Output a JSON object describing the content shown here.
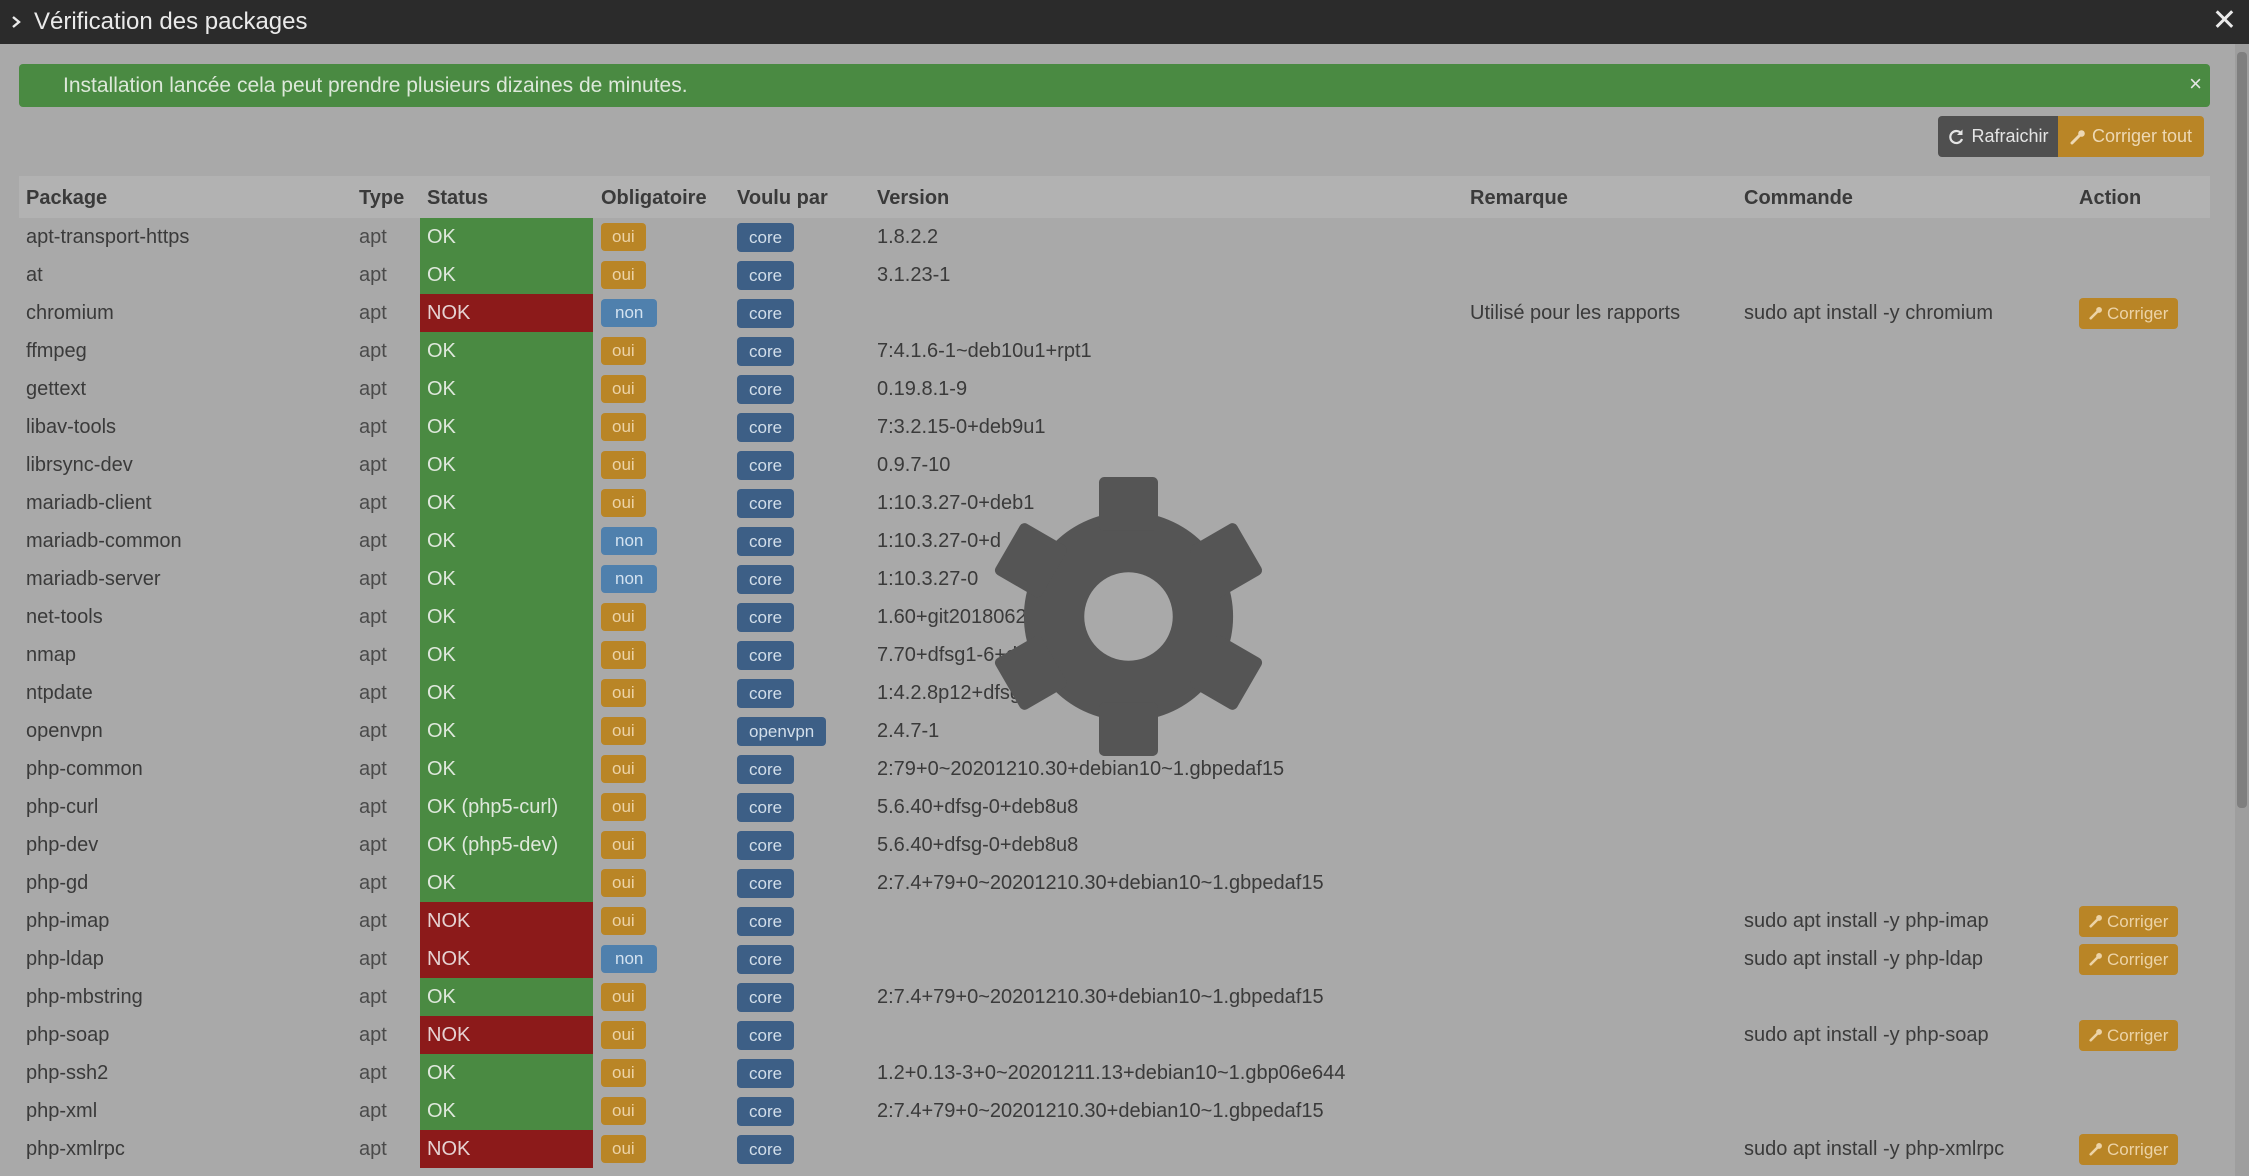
{
  "dialog": {
    "title": "Vérification des packages"
  },
  "alert": {
    "message": "Installation lancée cela peut prendre plusieurs dizaines de minutes.",
    "close": "×"
  },
  "toolbar": {
    "refresh_label": "Rafraichir",
    "fix_all_label": "Corriger tout"
  },
  "columns": {
    "package": "Package",
    "type": "Type",
    "status": "Status",
    "required": "Obligatoire",
    "wanted_by": "Voulu par",
    "version": "Version",
    "remark": "Remarque",
    "command": "Commande",
    "action": "Action"
  },
  "action_label": "Corriger",
  "rows": [
    {
      "package": "apt-transport-https",
      "type": "apt",
      "status": "OK",
      "ok": true,
      "required": "oui",
      "wanted_by": "core",
      "version": "1.8.2.2",
      "remark": "",
      "command": ""
    },
    {
      "package": "at",
      "type": "apt",
      "status": "OK",
      "ok": true,
      "required": "oui",
      "wanted_by": "core",
      "version": "3.1.23-1",
      "remark": "",
      "command": ""
    },
    {
      "package": "chromium",
      "type": "apt",
      "status": "NOK",
      "ok": false,
      "required": "non",
      "wanted_by": "core",
      "version": "",
      "remark": "Utilisé pour les rapports",
      "command": "sudo apt install -y chromium"
    },
    {
      "package": "ffmpeg",
      "type": "apt",
      "status": "OK",
      "ok": true,
      "required": "oui",
      "wanted_by": "core",
      "version": "7:4.1.6-1~deb10u1+rpt1",
      "remark": "",
      "command": ""
    },
    {
      "package": "gettext",
      "type": "apt",
      "status": "OK",
      "ok": true,
      "required": "oui",
      "wanted_by": "core",
      "version": "0.19.8.1-9",
      "remark": "",
      "command": ""
    },
    {
      "package": "libav-tools",
      "type": "apt",
      "status": "OK",
      "ok": true,
      "required": "oui",
      "wanted_by": "core",
      "version": "7:3.2.15-0+deb9u1",
      "remark": "",
      "command": ""
    },
    {
      "package": "librsync-dev",
      "type": "apt",
      "status": "OK",
      "ok": true,
      "required": "oui",
      "wanted_by": "core",
      "version": "0.9.7-10",
      "remark": "",
      "command": ""
    },
    {
      "package": "mariadb-client",
      "type": "apt",
      "status": "OK",
      "ok": true,
      "required": "oui",
      "wanted_by": "core",
      "version": "1:10.3.27-0+deb1",
      "remark": "",
      "command": ""
    },
    {
      "package": "mariadb-common",
      "type": "apt",
      "status": "OK",
      "ok": true,
      "required": "non",
      "wanted_by": "core",
      "version": "1:10.3.27-0+d",
      "remark": "",
      "command": ""
    },
    {
      "package": "mariadb-server",
      "type": "apt",
      "status": "OK",
      "ok": true,
      "required": "non",
      "wanted_by": "core",
      "version": "1:10.3.27-0",
      "remark": "",
      "command": ""
    },
    {
      "package": "net-tools",
      "type": "apt",
      "status": "OK",
      "ok": true,
      "required": "oui",
      "wanted_by": "core",
      "version": "1.60+git20180626.aebd88e-1",
      "remark": "",
      "command": ""
    },
    {
      "package": "nmap",
      "type": "apt",
      "status": "OK",
      "ok": true,
      "required": "oui",
      "wanted_by": "core",
      "version": "7.70+dfsg1-6+de",
      "remark": "",
      "command": ""
    },
    {
      "package": "ntpdate",
      "type": "apt",
      "status": "OK",
      "ok": true,
      "required": "oui",
      "wanted_by": "core",
      "version": "1:4.2.8p12+dfsg-",
      "remark": "",
      "command": ""
    },
    {
      "package": "openvpn",
      "type": "apt",
      "status": "OK",
      "ok": true,
      "required": "oui",
      "wanted_by": "openvpn",
      "version": "2.4.7-1",
      "remark": "",
      "command": ""
    },
    {
      "package": "php-common",
      "type": "apt",
      "status": "OK",
      "ok": true,
      "required": "oui",
      "wanted_by": "core",
      "version": "2:79+0~20201210.30+debian10~1.gbpedaf15",
      "remark": "",
      "command": ""
    },
    {
      "package": "php-curl",
      "type": "apt",
      "status": "OK (php5-curl)",
      "ok": true,
      "required": "oui",
      "wanted_by": "core",
      "version": "5.6.40+dfsg-0+deb8u8",
      "remark": "",
      "command": ""
    },
    {
      "package": "php-dev",
      "type": "apt",
      "status": "OK (php5-dev)",
      "ok": true,
      "required": "oui",
      "wanted_by": "core",
      "version": "5.6.40+dfsg-0+deb8u8",
      "remark": "",
      "command": ""
    },
    {
      "package": "php-gd",
      "type": "apt",
      "status": "OK",
      "ok": true,
      "required": "oui",
      "wanted_by": "core",
      "version": "2:7.4+79+0~20201210.30+debian10~1.gbpedaf15",
      "remark": "",
      "command": ""
    },
    {
      "package": "php-imap",
      "type": "apt",
      "status": "NOK",
      "ok": false,
      "required": "oui",
      "wanted_by": "core",
      "version": "",
      "remark": "",
      "command": "sudo apt install -y php-imap"
    },
    {
      "package": "php-ldap",
      "type": "apt",
      "status": "NOK",
      "ok": false,
      "required": "non",
      "wanted_by": "core",
      "version": "",
      "remark": "",
      "command": "sudo apt install -y php-ldap"
    },
    {
      "package": "php-mbstring",
      "type": "apt",
      "status": "OK",
      "ok": true,
      "required": "oui",
      "wanted_by": "core",
      "version": "2:7.4+79+0~20201210.30+debian10~1.gbpedaf15",
      "remark": "",
      "command": ""
    },
    {
      "package": "php-soap",
      "type": "apt",
      "status": "NOK",
      "ok": false,
      "required": "oui",
      "wanted_by": "core",
      "version": "",
      "remark": "",
      "command": "sudo apt install -y php-soap"
    },
    {
      "package": "php-ssh2",
      "type": "apt",
      "status": "OK",
      "ok": true,
      "required": "oui",
      "wanted_by": "core",
      "version": "1.2+0.13-3+0~20201211.13+debian10~1.gbp06e644",
      "remark": "",
      "command": ""
    },
    {
      "package": "php-xml",
      "type": "apt",
      "status": "OK",
      "ok": true,
      "required": "oui",
      "wanted_by": "core",
      "version": "2:7.4+79+0~20201210.30+debian10~1.gbpedaf15",
      "remark": "",
      "command": ""
    },
    {
      "package": "php-xmlrpc",
      "type": "apt",
      "status": "NOK",
      "ok": false,
      "required": "oui",
      "wanted_by": "core",
      "version": "",
      "remark": "",
      "command": "sudo apt install -y php-xmlrpc"
    }
  ],
  "icons": {
    "title": "chevron-right-icon",
    "close": "close-icon",
    "refresh": "refresh-icon",
    "fix": "wrench-icon",
    "loading": "gear-icon"
  },
  "colors": {
    "ok": "#4a8a42",
    "nok": "#8c1a1a",
    "oui": "#b98526",
    "non": "#4f80ad",
    "core": "#3d5f86"
  }
}
